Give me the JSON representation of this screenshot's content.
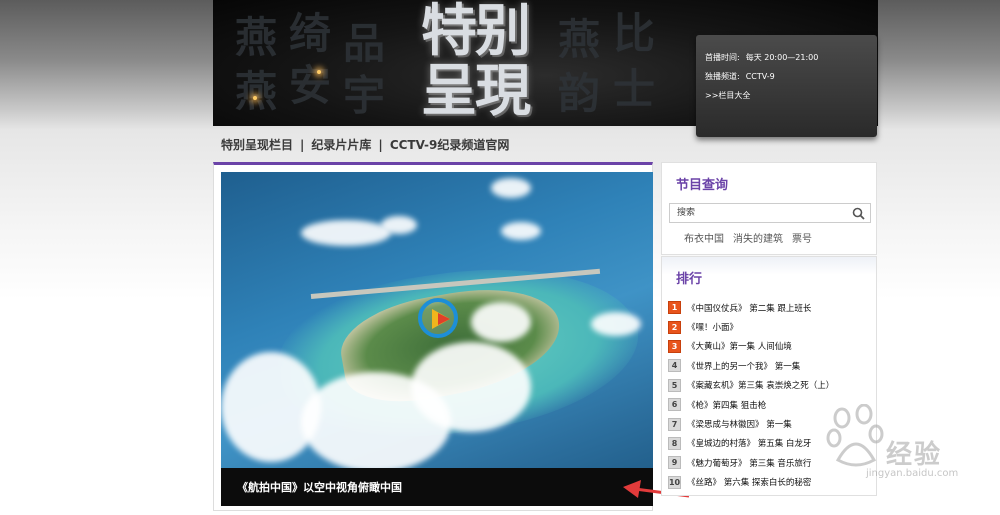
{
  "banner": {
    "title": "特别呈現",
    "airtime_label": "首播时间:",
    "airtime_value": "每天 20:00—21:00",
    "channel_label": "独播频道:",
    "channel_value": "CCTV-9",
    "all_programs_link": ">>栏目大全"
  },
  "nav": {
    "items": [
      "特别呈现栏目",
      "纪录片片库",
      "CCTV-9纪录频道官网"
    ],
    "separator": "|"
  },
  "video": {
    "caption": "《航拍中国》以空中视角俯瞰中国"
  },
  "program_search": {
    "title": "节目查询",
    "placeholder": "搜索",
    "hot_links": [
      "布衣中国",
      "消失的建筑",
      "票号"
    ]
  },
  "ranking": {
    "title": "排行",
    "items": [
      {
        "num": "1",
        "text": "《中国仪仗兵》 第二集 跟上班长"
      },
      {
        "num": "2",
        "text": "《嘿！小面》"
      },
      {
        "num": "3",
        "text": "《大黄山》第一集 人间仙境"
      },
      {
        "num": "4",
        "text": "《世界上的另一个我》 第一集"
      },
      {
        "num": "5",
        "text": "《案藏玄机》第三集 袁崇焕之死（上）"
      },
      {
        "num": "6",
        "text": "《枪》第四集 狙击枪"
      },
      {
        "num": "7",
        "text": "《梁思成与林徽因》 第一集"
      },
      {
        "num": "8",
        "text": "《皇城边的村落》 第五集 白龙牙"
      },
      {
        "num": "9",
        "text": "《魅力葡萄牙》 第三集 音乐旅行"
      },
      {
        "num": "10",
        "text": "《丝路》 第六集 探索白长的秘密"
      }
    ]
  },
  "watermark": {
    "brand": "经验",
    "url": "jingyan.baidu.com"
  },
  "colors": {
    "accent_purple": "#6b43a8",
    "rank_top": "#e8541c",
    "play_blue": "#1d8fd8"
  }
}
